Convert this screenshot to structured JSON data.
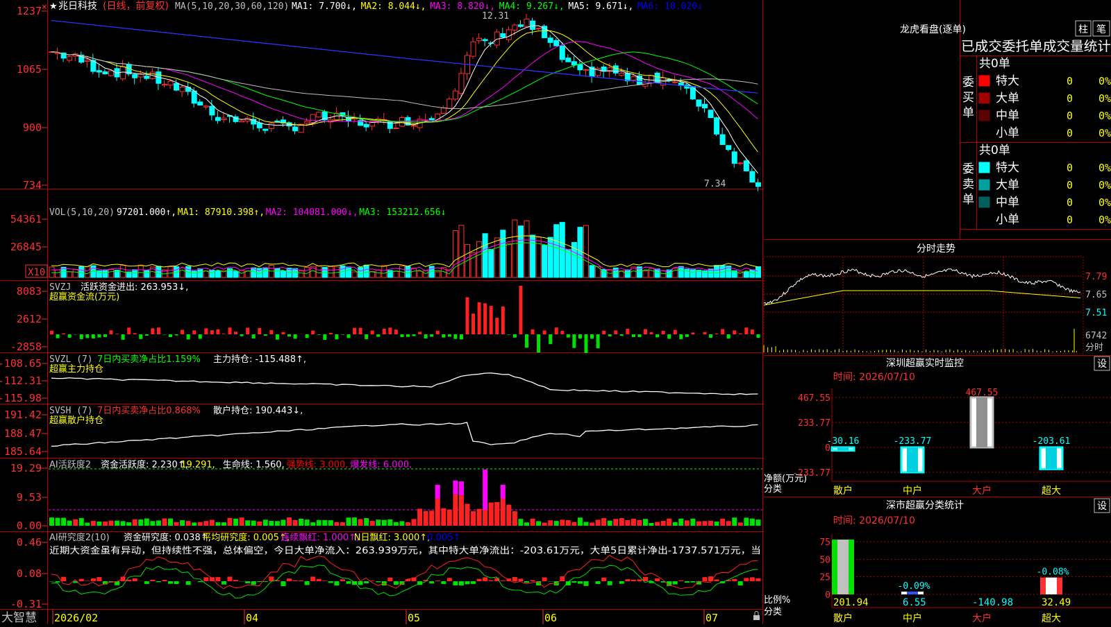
{
  "stock": {
    "star": "★",
    "name": "兆日科技",
    "period": "(日线，前复权)",
    "bottom_label": "大智慧"
  },
  "panels": {
    "main": {
      "y_ticks": [
        "1237",
        "1065",
        "900",
        "734"
      ],
      "ma_header": "MA(5,10,20,30,60,120)",
      "ma_items": [
        {
          "text": "MA1: 7.700↓,",
          "color": "#ffffff"
        },
        {
          "text": "MA2: 8.044↓,",
          "color": "#ffff00"
        },
        {
          "text": "MA3: 8.820↓,",
          "color": "#ff00ff"
        },
        {
          "text": "MA4: 9.267↓,",
          "color": "#00ff00"
        },
        {
          "text": "MA5: 9.671↓,",
          "color": "#ffffff"
        },
        {
          "text": "MA6: 10.020↓",
          "color": "#0000ff"
        }
      ],
      "high_label": "12.31",
      "low_label": "7.34"
    },
    "vol": {
      "y_ticks": [
        "54361",
        "26845",
        "X10"
      ],
      "header": "VOL(5,10,20)",
      "items": [
        {
          "text": "97201.000↑,",
          "color": "#ffffff"
        },
        {
          "text": "MA1: 87910.398↑,",
          "color": "#ffff00"
        },
        {
          "text": "MA2: 104081.000↓,",
          "color": "#ff00ff"
        },
        {
          "text": "MA3: 153212.656↓",
          "color": "#00ff00"
        }
      ]
    },
    "svzj": {
      "y_ticks": [
        "8083",
        "2612",
        "-2858"
      ],
      "header": "SVZJ",
      "label": "活跃资金进出: 263.953↓,",
      "sub": "超赢资金流(万元)"
    },
    "svzl": {
      "y_ticks": [
        "-108.65",
        "-112.31",
        "-115.98"
      ],
      "header": "SVZL (7)",
      "green_text": "7日内买卖净占比1.159%",
      "value_text": "主力持仓: -115.488↑,",
      "sub": "超赢主力持仓"
    },
    "svsh": {
      "y_ticks": [
        "191.42",
        "188.47",
        "185.64"
      ],
      "header": "SVSH (7)",
      "red_text": "7日内买卖净占比0.868%",
      "value_text": "散户持仓: 190.443↓,",
      "sub": "超赢散户持仓"
    },
    "ai2": {
      "y_ticks": [
        "19.29",
        "9.53",
        "0.00"
      ],
      "header": "AI活跃度2",
      "items": [
        {
          "text": "资金活跃度: 2.230↑,",
          "color": "#ffffff"
        },
        {
          "text": "19.291,",
          "color": "#ffff00"
        },
        {
          "text": "生命线: 1.560,",
          "color": "#ffffff"
        },
        {
          "text": "强势线: 3.000,",
          "color": "#ff0000"
        },
        {
          "text": "爆发线: 6.000,",
          "color": "#ff00ff"
        }
      ]
    },
    "ai_research": {
      "y_ticks": [
        "0.46",
        "0.08",
        "-0.31"
      ],
      "header": "AI研究度2(10)",
      "items": [
        {
          "text": "资金研究度: 0.038↑,",
          "color": "#ffffff"
        },
        {
          "text": "平均研究度: 0.005↑,",
          "color": "#ffff00"
        },
        {
          "text": "连续飘红: 1.000↑,",
          "color": "#ff00ff"
        },
        {
          "text": "N日飘红: 3.000↑,",
          "color": "#ffff00"
        },
        {
          "text": "0.005↑",
          "color": "#0000ff"
        }
      ],
      "commentary": "近期大资金虽有异动，但持续性不强，总体偏空，今日大单净流入：263.939万元，其中特大单净流出：-203.61万元，大单5日累计净出-1737.571万元，当"
    }
  },
  "x_axis": {
    "labels": [
      "2026/02",
      "04",
      "05",
      "06",
      "07"
    ]
  },
  "right": {
    "lhb": {
      "title": "龙虎看盘(逐单)",
      "btn_bar": "柱",
      "btn_pen": "笔",
      "stats_title": "已成交委托单成交量统计",
      "buy": {
        "label": "委买单",
        "total": "共0单",
        "rows": [
          {
            "name": "特大",
            "count": "0",
            "pct": "0%",
            "color": "#ff0000"
          },
          {
            "name": "大单",
            "count": "0",
            "pct": "0%",
            "color": "#a00000"
          },
          {
            "name": "中单",
            "count": "0",
            "pct": "0%",
            "color": "#600000"
          },
          {
            "name": "小单",
            "count": "0",
            "pct": "0%",
            "color": "#000000"
          }
        ]
      },
      "sell": {
        "label": "委卖单",
        "total": "共0单",
        "rows": [
          {
            "name": "特大",
            "count": "0",
            "pct": "0%",
            "color": "#00ffff"
          },
          {
            "name": "大单",
            "count": "0",
            "pct": "0%",
            "color": "#00a0a0"
          },
          {
            "name": "中单",
            "count": "0",
            "pct": "0%",
            "color": "#006060"
          },
          {
            "name": "小单",
            "count": "0",
            "pct": "0%",
            "color": "#000000"
          }
        ]
      }
    },
    "intraday": {
      "title": "分时走势",
      "y_ticks": [
        "7.79",
        "7.65",
        "7.51"
      ],
      "vol_top": "6742",
      "vol_label": "分时"
    },
    "monitor": {
      "title": "深圳超赢实时监控",
      "btn": "设",
      "time": "时间: 2026/07/10",
      "y_ticks": [
        "467.55",
        "233.77",
        "0",
        "-233.77"
      ],
      "y_unit": "净额(万元)",
      "x_title": "分类",
      "categories": [
        "散户",
        "中户",
        "大户",
        "超大"
      ],
      "values": [
        -30.16,
        -233.77,
        467.55,
        -203.61
      ],
      "value_labels": [
        "-30.16",
        "-233.77",
        "467.55",
        "-203.61"
      ]
    },
    "classify": {
      "title": "深市超赢分类统计",
      "btn": "设",
      "time": "时间: 2026/07/10",
      "y_ticks": [
        "75",
        "50",
        "25",
        "0"
      ],
      "y_unit": "比例%",
      "x_title": "分类",
      "categories": [
        "散户",
        "中户",
        "大户",
        "超大"
      ],
      "values": [
        201.94,
        6.55,
        -140.98,
        32.49
      ],
      "value_labels": [
        "201.94",
        "6.55",
        "-140.98",
        "32.49"
      ],
      "pct_labels": [
        "",
        "-0.09%",
        "",
        "-0.08%"
      ]
    }
  }
}
